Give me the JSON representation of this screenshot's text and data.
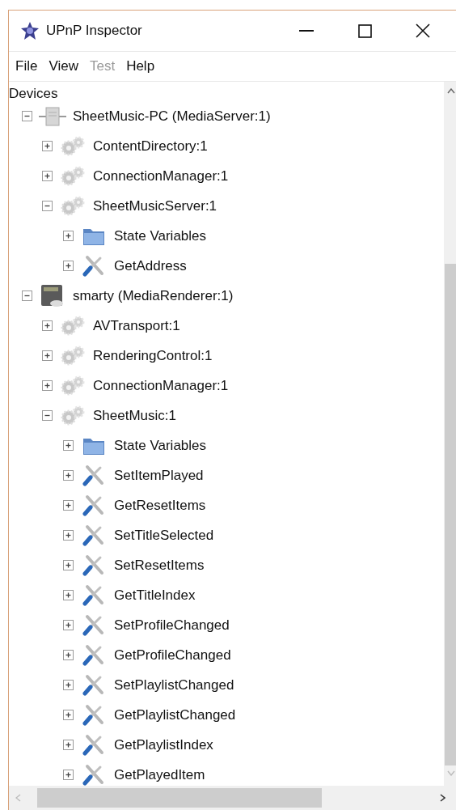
{
  "window": {
    "title": "UPnP Inspector"
  },
  "menu": [
    {
      "label": "File",
      "disabled": false
    },
    {
      "label": "View",
      "disabled": false
    },
    {
      "label": "Test",
      "disabled": true
    },
    {
      "label": "Help",
      "disabled": false
    }
  ],
  "tree": {
    "heading": "Devices",
    "items": [
      {
        "kind": "server",
        "label": "SheetMusic-PC (MediaServer:1)",
        "expanded": true,
        "children": [
          {
            "kind": "service",
            "label": "ContentDirectory:1",
            "expanded": false
          },
          {
            "kind": "service",
            "label": "ConnectionManager:1",
            "expanded": false
          },
          {
            "kind": "service",
            "label": "SheetMusicServer:1",
            "expanded": true,
            "children": [
              {
                "kind": "folder",
                "label": "State Variables",
                "expanded": false
              },
              {
                "kind": "action",
                "label": "GetAddress",
                "expanded": false
              }
            ]
          }
        ]
      },
      {
        "kind": "renderer",
        "label": "smarty (MediaRenderer:1)",
        "expanded": true,
        "children": [
          {
            "kind": "service",
            "label": "AVTransport:1",
            "expanded": false
          },
          {
            "kind": "service",
            "label": "RenderingControl:1",
            "expanded": false
          },
          {
            "kind": "service",
            "label": "ConnectionManager:1",
            "expanded": false
          },
          {
            "kind": "service",
            "label": "SheetMusic:1",
            "expanded": true,
            "children": [
              {
                "kind": "folder",
                "label": "State Variables",
                "expanded": false
              },
              {
                "kind": "action",
                "label": "SetItemPlayed",
                "expanded": false
              },
              {
                "kind": "action",
                "label": "GetResetItems",
                "expanded": false
              },
              {
                "kind": "action",
                "label": "SetTitleSelected",
                "expanded": false
              },
              {
                "kind": "action",
                "label": "SetResetItems",
                "expanded": false
              },
              {
                "kind": "action",
                "label": "GetTitleIndex",
                "expanded": false
              },
              {
                "kind": "action",
                "label": "SetProfileChanged",
                "expanded": false
              },
              {
                "kind": "action",
                "label": "GetProfileChanged",
                "expanded": false
              },
              {
                "kind": "action",
                "label": "SetPlaylistChanged",
                "expanded": false
              },
              {
                "kind": "action",
                "label": "GetPlaylistChanged",
                "expanded": false
              },
              {
                "kind": "action",
                "label": "GetPlaylistIndex",
                "expanded": false
              },
              {
                "kind": "action",
                "label": "GetPlayedItem",
                "expanded": false
              }
            ]
          }
        ]
      }
    ]
  }
}
